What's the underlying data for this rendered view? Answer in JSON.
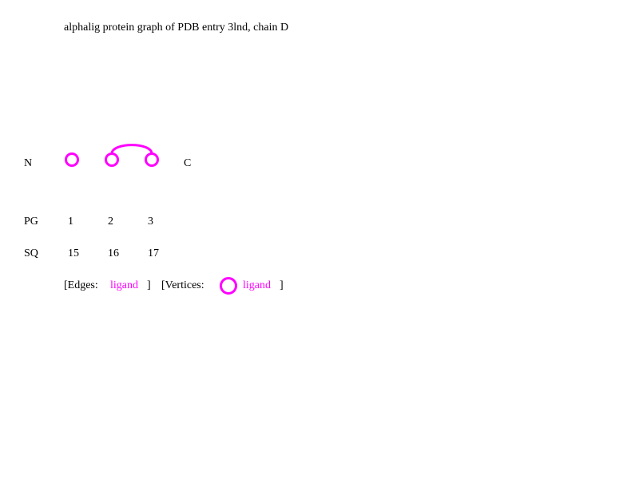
{
  "title": "alphalig protein graph of PDB entry 3lnd, chain D",
  "terminus": {
    "n": "N",
    "c": "C"
  },
  "rows": {
    "pg_label": "PG",
    "sq_label": "SQ"
  },
  "vertices": [
    {
      "pg": "1",
      "sq": "15"
    },
    {
      "pg": "2",
      "sq": "16"
    },
    {
      "pg": "3",
      "sq": "17"
    }
  ],
  "edges": [
    {
      "from": 2,
      "to": 3,
      "type": "ligand"
    }
  ],
  "legend": {
    "edges_open": "[Edges:",
    "edges_type": "ligand",
    "edges_close": "]",
    "vertices_open": "[Vertices:",
    "vertices_type": "ligand",
    "vertices_close": "]"
  },
  "colors": {
    "ligand": "#ff00ff"
  }
}
